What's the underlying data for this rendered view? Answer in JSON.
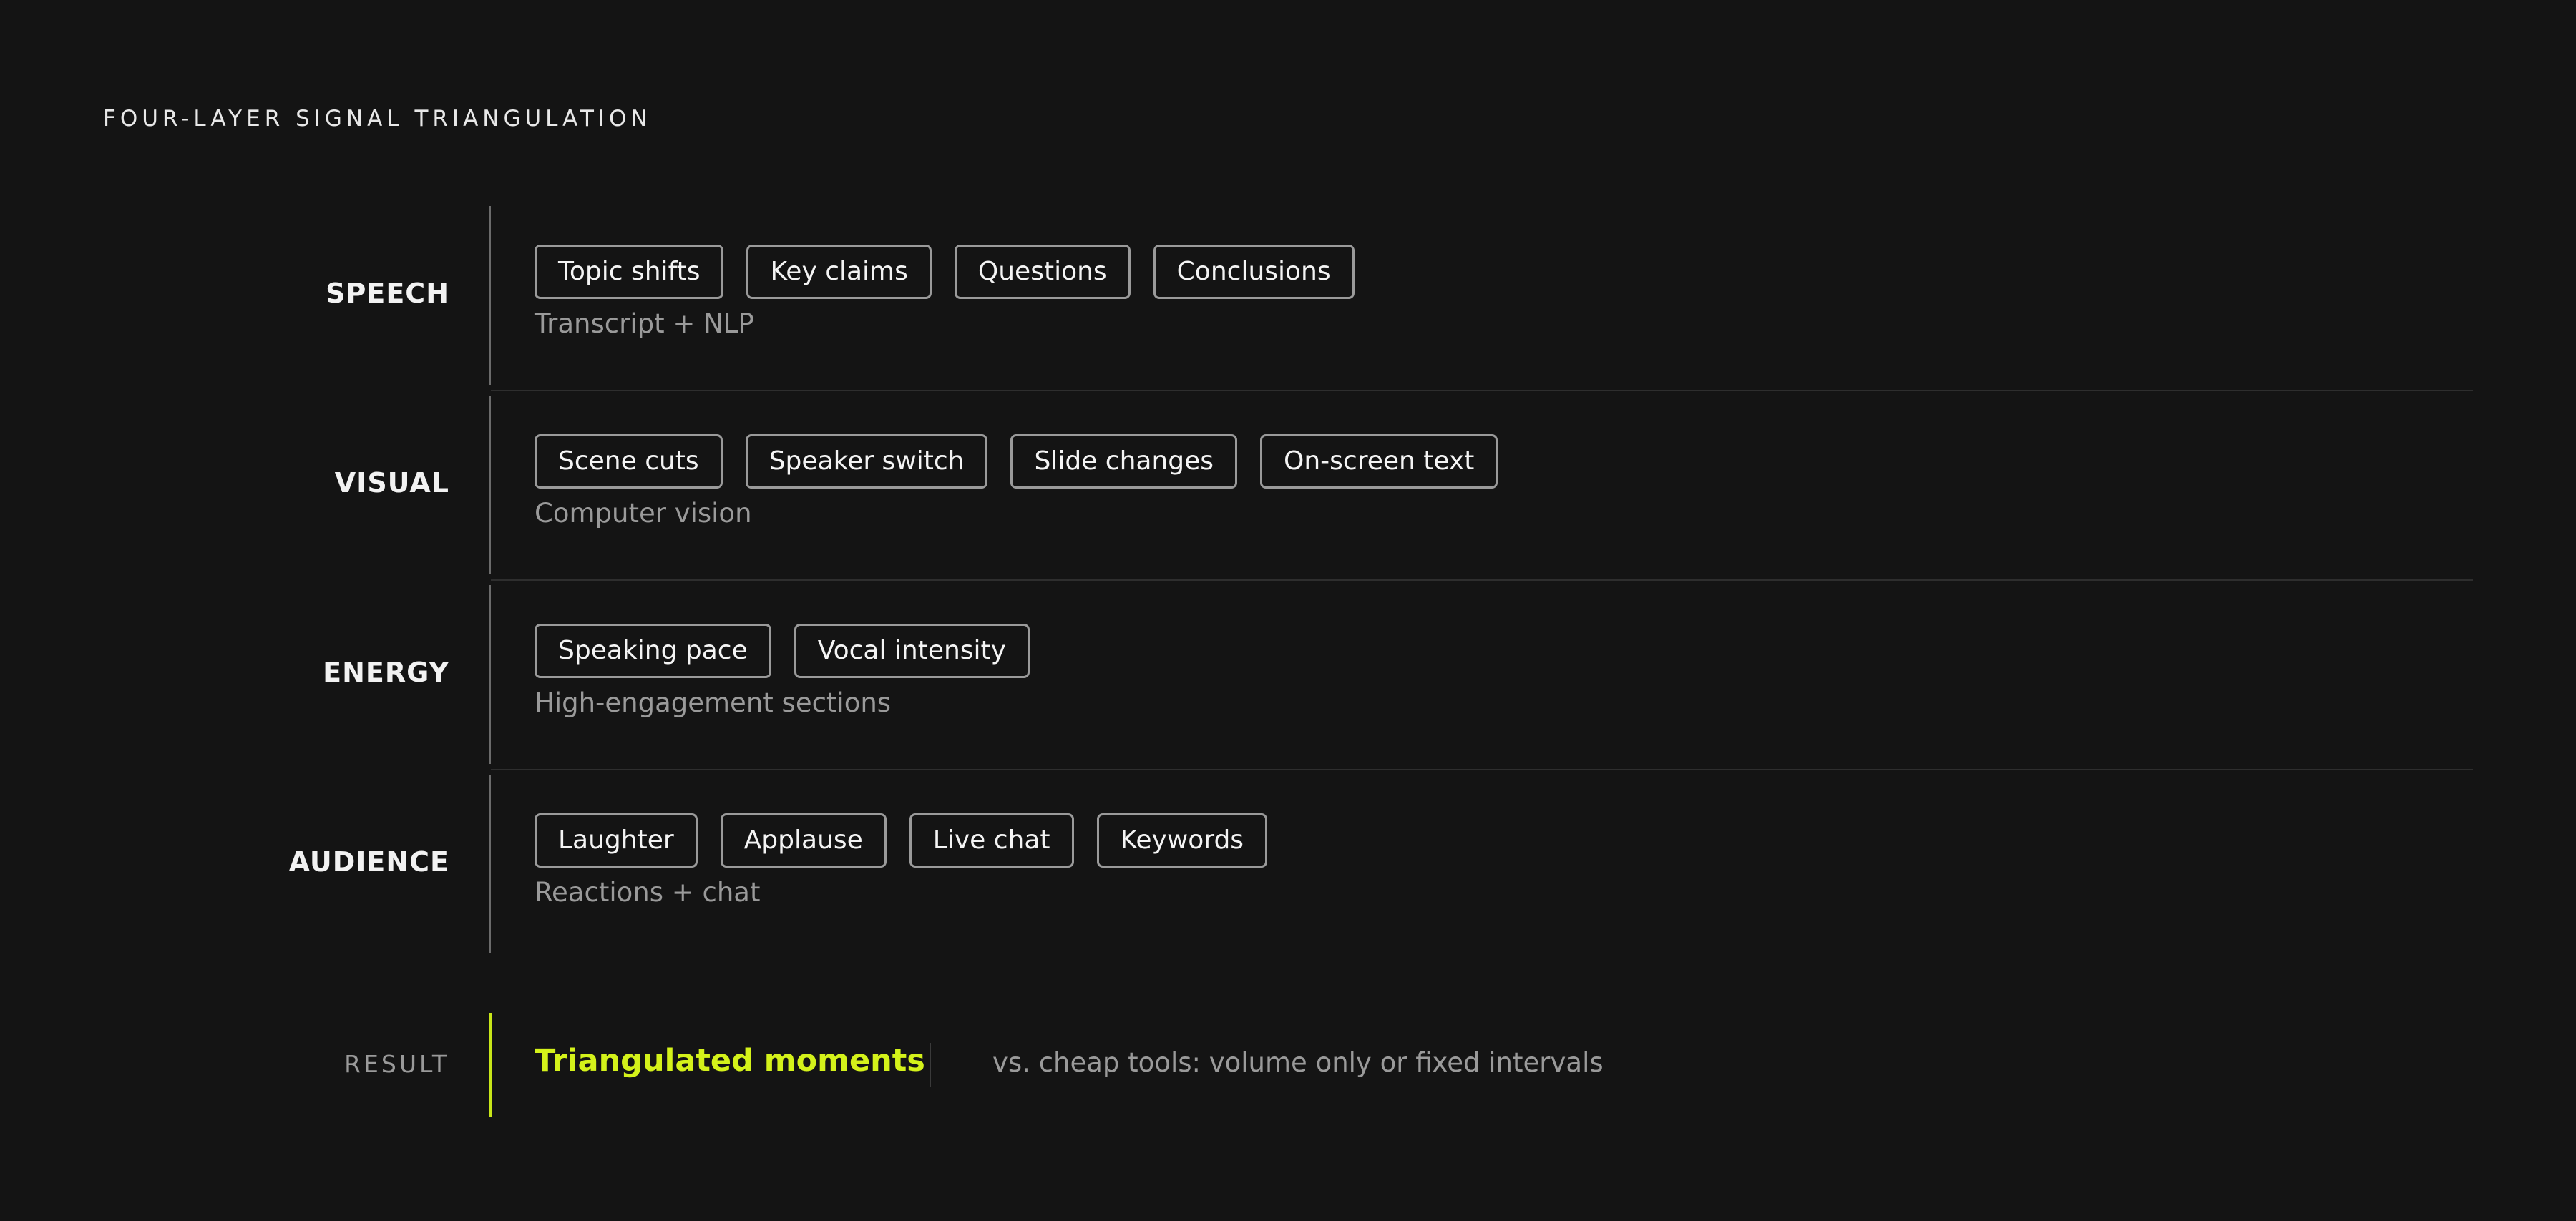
{
  "title": "FOUR-LAYER SIGNAL TRIANGULATION",
  "layers": [
    {
      "label": "SPEECH",
      "chips": [
        "Topic shifts",
        "Key claims",
        "Questions",
        "Conclusions"
      ],
      "source": "Transcript + NLP"
    },
    {
      "label": "VISUAL",
      "chips": [
        "Scene cuts",
        "Speaker switch",
        "Slide changes",
        "On-screen text"
      ],
      "source": "Computer vision"
    },
    {
      "label": "ENERGY",
      "chips": [
        "Speaking pace",
        "Vocal intensity"
      ],
      "source": "High-engagement sections"
    },
    {
      "label": "AUDIENCE",
      "chips": [
        "Laughter",
        "Applause",
        "Live chat",
        "Keywords"
      ],
      "source": "Reactions + chat"
    }
  ],
  "result": {
    "label": "RESULT",
    "main": "Triangulated moments",
    "note": "vs. cheap tools: volume only or fixed intervals"
  },
  "colors": {
    "background": "#141414",
    "accent": "#d4f21a",
    "chip_border": "#9a9a9a",
    "muted_text": "#9a9a9a"
  }
}
